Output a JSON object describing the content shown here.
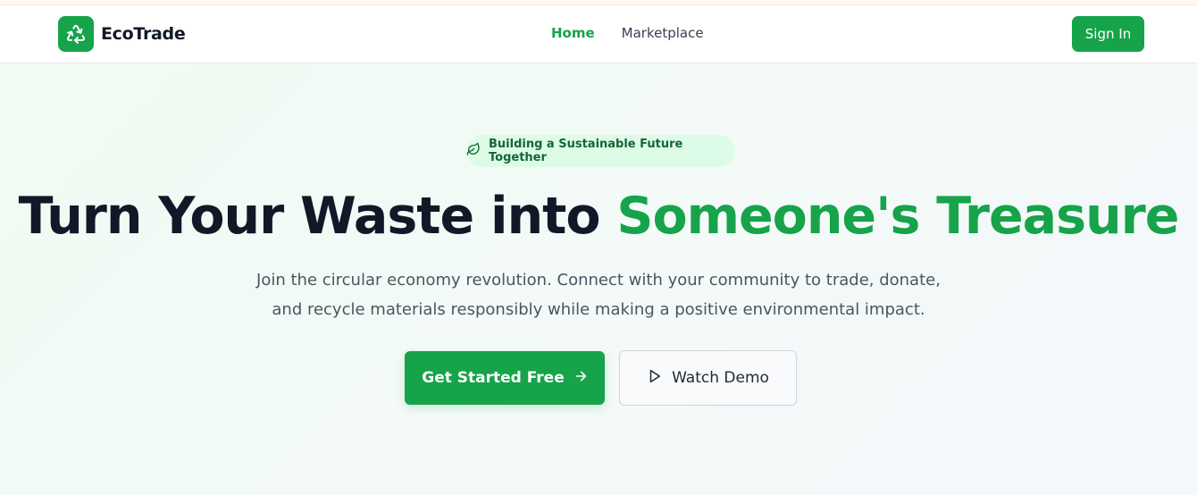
{
  "brand": {
    "name": "EcoTrade",
    "logo_icon": "recycle-icon"
  },
  "nav": {
    "links": [
      {
        "label": "Home",
        "active": true
      },
      {
        "label": "Marketplace",
        "active": false
      }
    ],
    "signin_label": "Sign In"
  },
  "hero": {
    "badge": {
      "icon": "leaf-icon",
      "text": "Building a Sustainable Future Together"
    },
    "headline_part1": "Turn Your Waste into ",
    "headline_accent": "Someone's Treasure",
    "subtitle_line1": "Join the circular economy revolution. Connect with your community to trade, donate,",
    "subtitle_line2": "and recycle materials responsibly while making a positive environmental impact.",
    "cta_primary": {
      "label": "Get Started Free",
      "icon": "arrow-right-icon"
    },
    "cta_secondary": {
      "label": "Watch Demo",
      "icon": "play-icon"
    }
  },
  "colors": {
    "accent": "#16a34a",
    "heading": "#111827",
    "badge_bg": "#dcfce7",
    "badge_text": "#166534"
  }
}
